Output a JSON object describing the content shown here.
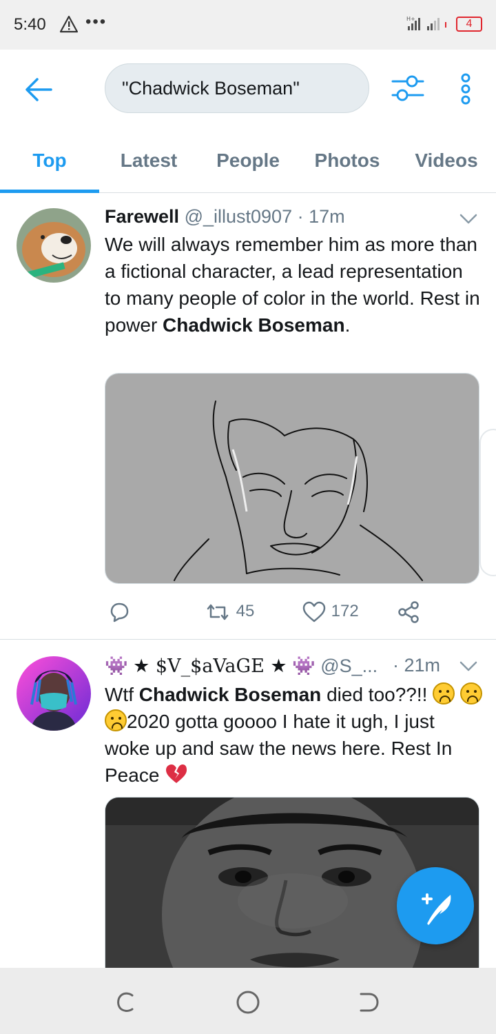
{
  "status_bar": {
    "time": "5:40",
    "dots": "•••",
    "battery": "4"
  },
  "header": {
    "search_value": "\"Chadwick Boseman\""
  },
  "tabs": [
    {
      "label": "Top",
      "active": true
    },
    {
      "label": "Latest",
      "active": false
    },
    {
      "label": "People",
      "active": false
    },
    {
      "label": "Photos",
      "active": false
    },
    {
      "label": "Videos",
      "active": false
    }
  ],
  "tweets": [
    {
      "name": "Farewell",
      "handle": "@_illust0907",
      "sep": "·",
      "time": "17m",
      "text_parts": [
        "We will always remember him as more than a fictional character, a lead representation to many people of color in the world. Rest in power ",
        "Chadwick Boseman",
        "."
      ],
      "replies": "",
      "retweets": "45",
      "likes": "172",
      "image_icon": "sketch-portrait-image"
    },
    {
      "name_prefix": "👾",
      "name": "★ $V_$aVaGE ★",
      "name_suffix": "👾",
      "handle": "@S_...",
      "sep": "·",
      "time": "21m",
      "text_parts": [
        "Wtf ",
        "Chadwick Boseman",
        " died too??!! ",
        "2020 gotta goooo I hate it ugh, I just woke up and saw the news here. Rest In Peace "
      ],
      "image_icon": "bw-portrait-photo"
    }
  ],
  "colors": {
    "accent": "#1d9bf0",
    "text_secondary": "#657786",
    "battery_low": "#e0262e"
  }
}
